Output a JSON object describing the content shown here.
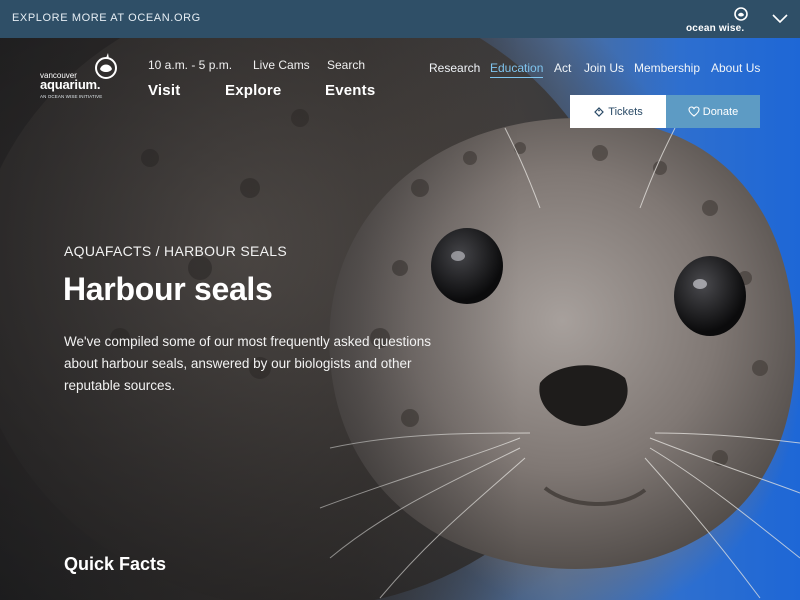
{
  "topbar": {
    "link_label": "EXPLORE MORE AT OCEAN.ORG",
    "brand_text": "ocean wise."
  },
  "logo": {
    "line1": "vancouver",
    "line2": "aquarium.",
    "tagline": "AN OCEAN WISE INITIATIVE"
  },
  "utility_nav": {
    "hours": "10 a.m. - 5 p.m.",
    "live_cams": "Live Cams",
    "search": "Search"
  },
  "main_nav": [
    "Visit",
    "Explore",
    "Events"
  ],
  "right_nav": [
    "Research",
    "Education",
    "Act",
    "Join Us",
    "Membership",
    "About Us"
  ],
  "right_nav_active": "Education",
  "buttons": {
    "tickets": "Tickets",
    "donate": "Donate"
  },
  "hero": {
    "breadcrumb": "AQUAFACTS / HARBOUR SEALS",
    "title": "Harbour seals",
    "intro": "We've compiled some of our most frequently asked questions about harbour seals, answered by our biologists and other reputable sources.",
    "section_heading": "Quick Facts"
  },
  "colors": {
    "topbar_bg": "#2f4f67",
    "donate_bg": "#5d9bc4",
    "active_nav": "#7fc4ee",
    "ocean_blue": "#1e67d6"
  }
}
